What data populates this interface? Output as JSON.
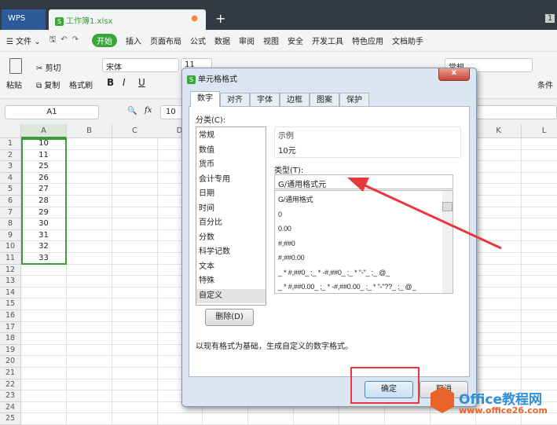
{
  "app": {
    "brand": "WPS",
    "doc_tab": "工作簿1.xlsx",
    "page_num": "1"
  },
  "menu": [
    "文件",
    "开始",
    "插入",
    "页面布局",
    "公式",
    "数据",
    "审阅",
    "视图",
    "安全",
    "开发工具",
    "特色应用",
    "文档助手"
  ],
  "ribbon": {
    "paste": "粘贴",
    "cut": "剪切",
    "copy": "复制",
    "format_painter": "格式刷",
    "font": "宋体",
    "font_size": "11",
    "bold": "B",
    "italic": "I",
    "underline": "U",
    "number_format": "常规",
    "cond": "条件"
  },
  "formula_bar": {
    "cell_ref": "A1",
    "fx": "fx",
    "value": "10"
  },
  "sheet": {
    "columns": [
      "A",
      "B",
      "C",
      "D",
      "K",
      "L"
    ],
    "rows": [
      "1",
      "2",
      "3",
      "4",
      "5",
      "6",
      "7",
      "8",
      "9",
      "10",
      "11",
      "12",
      "13",
      "14",
      "15",
      "16",
      "17",
      "18",
      "19",
      "20",
      "21",
      "22",
      "23",
      "24",
      "25"
    ],
    "a_values": [
      "10",
      "11",
      "25",
      "26",
      "27",
      "28",
      "29",
      "30",
      "31",
      "32",
      "33"
    ]
  },
  "dialog": {
    "title": "单元格格式",
    "tabs": [
      "数字",
      "对齐",
      "字体",
      "边框",
      "图案",
      "保护"
    ],
    "category_label": "分类(C):",
    "categories": [
      "常规",
      "数值",
      "货币",
      "会计专用",
      "日期",
      "时间",
      "百分比",
      "分数",
      "科学记数",
      "文本",
      "特殊",
      "自定义"
    ],
    "selected_category": "自定义",
    "sample_label": "示例",
    "sample_value": "10元",
    "type_label": "类型(T):",
    "type_value": "G/通用格式元",
    "type_list": [
      "G/通用格式",
      "0",
      "0.00",
      "#,##0",
      "#,##0.00",
      "_ * #,##0_ ;_ * -#,##0_ ;_ * \"-\"_ ;_ @_",
      "_ * #,##0.00_ ;_ * -#,##0.00_ ;_ * \"-\"??_ ;_ @_"
    ],
    "delete_button": "删除(D)",
    "hint": "以现有格式为基础，生成自定义的数字格式。",
    "ok": "确定",
    "cancel": "取消"
  },
  "watermark": {
    "name": "Office教程网",
    "url": "www.office26.com"
  },
  "colors": {
    "accent_green": "#3aa63a",
    "annotation_red": "#e8383d",
    "selection": "#3c9a3c"
  }
}
